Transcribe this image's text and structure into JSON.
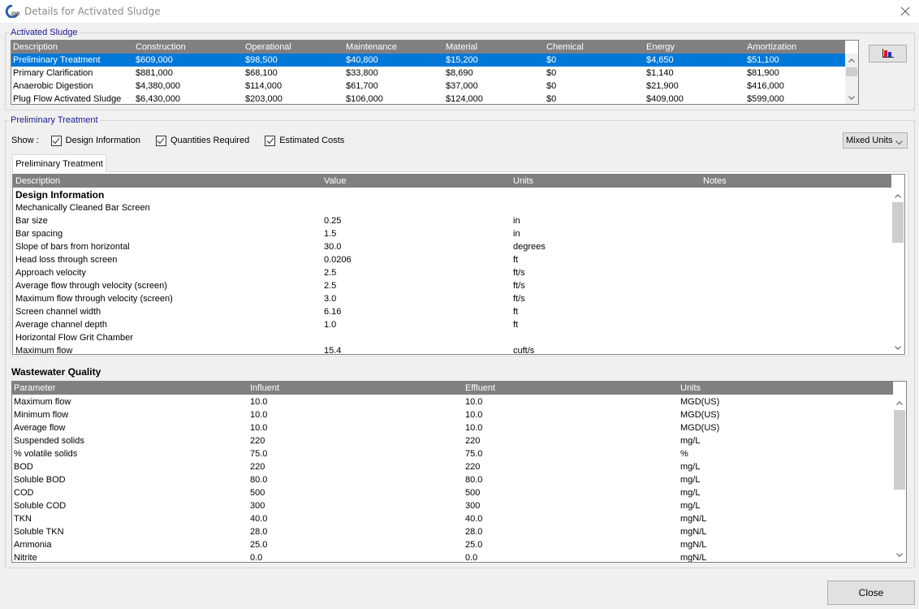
{
  "window": {
    "title": "Details for Activated Sludge",
    "app_icon": "gps-x-logo-icon",
    "close_icon": "close-icon"
  },
  "summary": {
    "group_label": "Activated Sludge",
    "columns": [
      "Description",
      "Construction",
      "Operational",
      "Maintenance",
      "Material",
      "Chemical",
      "Energy",
      "Amortization"
    ],
    "rows": [
      [
        "Preliminary Treatment",
        "$609,000",
        "$98,500",
        "$40,800",
        "$15,200",
        "$0",
        "$4,650",
        "$51,100"
      ],
      [
        "Primary Clarification",
        "$881,000",
        "$68,100",
        "$33,800",
        "$8,690",
        "$0",
        "$1,140",
        "$81,900"
      ],
      [
        "Anaerobic Digestion",
        "$4,380,000",
        "$114,000",
        "$61,700",
        "$37,000",
        "$0",
        "$21,900",
        "$416,000"
      ],
      [
        "Plug Flow Activated Sludge",
        "$6,430,000",
        "$203,000",
        "$106,000",
        "$124,000",
        "$0",
        "$409,000",
        "$599,000"
      ]
    ],
    "selected_row": 0,
    "chart_button_icon": "bar-chart-icon"
  },
  "detail": {
    "group_label": "Preliminary Treatment",
    "show_label": "Show :",
    "checkboxes": [
      {
        "label": "Design Information",
        "checked": true
      },
      {
        "label": "Quantities Required",
        "checked": true
      },
      {
        "label": "Estimated Costs",
        "checked": true
      }
    ],
    "units_select": "Mixed Units",
    "tab_label": "Preliminary Treatment",
    "columns": [
      "Description",
      "Value",
      "Units",
      "Notes"
    ],
    "rows": [
      {
        "desc": "Design Information",
        "value": "",
        "units": "",
        "notes": "",
        "heading": true
      },
      {
        "desc": "Mechanically Cleaned Bar Screen",
        "value": "",
        "units": "",
        "notes": ""
      },
      {
        "desc": "Bar size",
        "value": "0.25",
        "units": "in",
        "notes": ""
      },
      {
        "desc": "Bar spacing",
        "value": "1.5",
        "units": "in",
        "notes": ""
      },
      {
        "desc": "Slope of bars from horizontal",
        "value": "30.0",
        "units": "degrees",
        "notes": ""
      },
      {
        "desc": "Head loss through screen",
        "value": "0.0206",
        "units": "ft",
        "notes": ""
      },
      {
        "desc": "Approach velocity",
        "value": "2.5",
        "units": "ft/s",
        "notes": ""
      },
      {
        "desc": "Average flow through velocity (screen)",
        "value": "2.5",
        "units": "ft/s",
        "notes": ""
      },
      {
        "desc": "Maximum flow through velocity (screen)",
        "value": "3.0",
        "units": "ft/s",
        "notes": ""
      },
      {
        "desc": "Screen channel width",
        "value": "6.16",
        "units": "ft",
        "notes": ""
      },
      {
        "desc": "Average channel depth",
        "value": "1.0",
        "units": "ft",
        "notes": ""
      },
      {
        "desc": "Horizontal Flow Grit Chamber",
        "value": "",
        "units": "",
        "notes": ""
      },
      {
        "desc": "Maximum flow",
        "value": "15.4",
        "units": "cuft/s",
        "notes": ""
      }
    ]
  },
  "quality": {
    "title": "Wastewater Quality",
    "columns": [
      "Parameter",
      "Influent",
      "Effluent",
      "Units"
    ],
    "rows": [
      [
        "Maximum flow",
        "10.0",
        "10.0",
        "MGD(US)"
      ],
      [
        "Minimum flow",
        "10.0",
        "10.0",
        "MGD(US)"
      ],
      [
        "Average flow",
        "10.0",
        "10.0",
        "MGD(US)"
      ],
      [
        "Suspended solids",
        "220",
        "220",
        "mg/L"
      ],
      [
        "% volatile solids",
        "75.0",
        "75.0",
        "%"
      ],
      [
        "BOD",
        "220",
        "220",
        "mg/L"
      ],
      [
        "Soluble BOD",
        "80.0",
        "80.0",
        "mg/L"
      ],
      [
        "COD",
        "500",
        "500",
        "mg/L"
      ],
      [
        "Soluble COD",
        "300",
        "300",
        "mg/L"
      ],
      [
        "TKN",
        "40.0",
        "40.0",
        "mgN/L"
      ],
      [
        "Soluble TKN",
        "28.0",
        "28.0",
        "mgN/L"
      ],
      [
        "Ammonia",
        "25.0",
        "25.0",
        "mgN/L"
      ],
      [
        "Nitrite",
        "0.0",
        "0.0",
        "mgN/L"
      ]
    ]
  },
  "footer": {
    "close_label": "Close"
  }
}
